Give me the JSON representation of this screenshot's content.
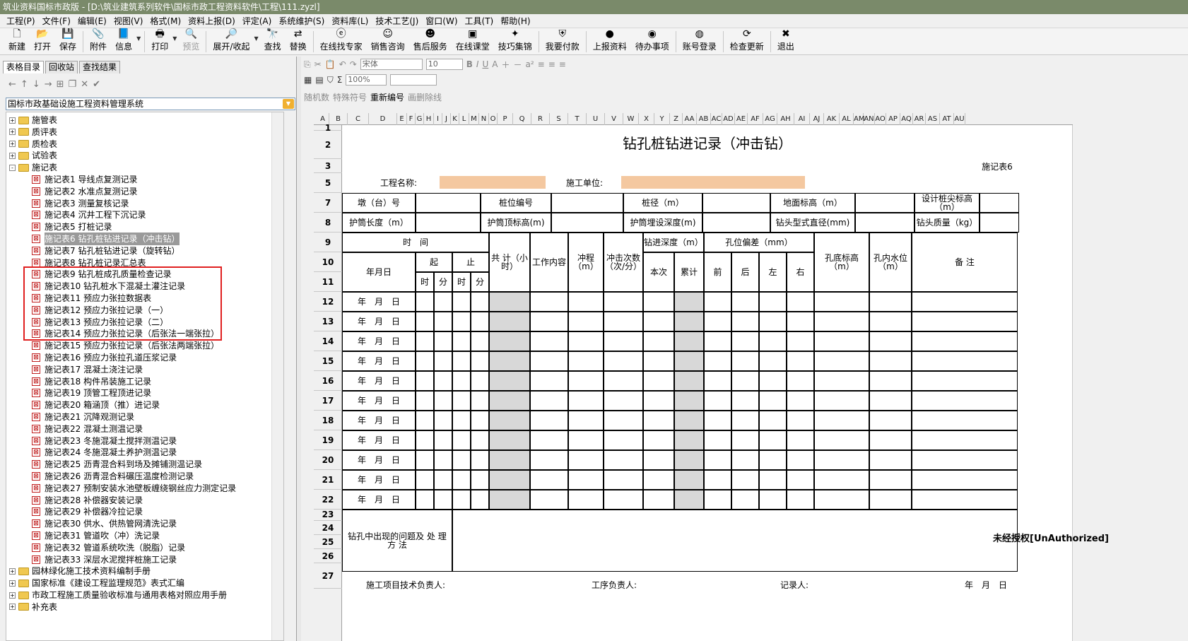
{
  "window": {
    "title": "筑业资料国标市政版 - [D:\\筑业建筑系列软件\\国标市政工程资料软件\\工程\\111.zyzl]"
  },
  "menu": [
    {
      "id": "project",
      "label": "工程(P)"
    },
    {
      "id": "file",
      "label": "文件(F)"
    },
    {
      "id": "edit",
      "label": "编辑(E)"
    },
    {
      "id": "view",
      "label": "视图(V)"
    },
    {
      "id": "format",
      "label": "格式(M)"
    },
    {
      "id": "upload",
      "label": "资料上报(D)"
    },
    {
      "id": "evaluate",
      "label": "评定(A)"
    },
    {
      "id": "maintain",
      "label": "系统维护(S)"
    },
    {
      "id": "library",
      "label": "资料库(L)"
    },
    {
      "id": "tech",
      "label": "技术工艺(J)"
    },
    {
      "id": "window",
      "label": "窗口(W)"
    },
    {
      "id": "tools",
      "label": "工具(T)"
    },
    {
      "id": "help",
      "label": "帮助(H)"
    }
  ],
  "toolbar": [
    {
      "id": "new",
      "label": "新建",
      "icon": "new-doc-icon",
      "glyph": "🗋"
    },
    {
      "id": "open",
      "label": "打开",
      "icon": "open-folder-icon",
      "glyph": "📂"
    },
    {
      "id": "save",
      "label": "保存",
      "icon": "save-icon",
      "glyph": "💾"
    },
    {
      "id": "attach",
      "label": "附件",
      "icon": "attachment-icon",
      "glyph": "📎",
      "sep": true
    },
    {
      "id": "info",
      "label": "信息",
      "icon": "info-icon",
      "glyph": "📘",
      "arrow": true
    },
    {
      "id": "print",
      "label": "打印",
      "icon": "printer-icon",
      "glyph": "🖶",
      "arrow": true,
      "sep": true
    },
    {
      "id": "preview",
      "label": "预览",
      "icon": "preview-icon",
      "glyph": "🔍",
      "disabled": true
    },
    {
      "id": "expand",
      "label": "展开/收起",
      "icon": "expand-icon",
      "glyph": "🔎",
      "arrow": true,
      "sep": true
    },
    {
      "id": "find",
      "label": "查找",
      "icon": "binoculars-icon",
      "glyph": "🔭"
    },
    {
      "id": "replace",
      "label": "替换",
      "icon": "replace-icon",
      "glyph": "⇄"
    },
    {
      "id": "expert",
      "label": "在线找专家",
      "icon": "expert-icon",
      "glyph": "ⓔ",
      "sep": true
    },
    {
      "id": "sales",
      "label": "销售咨询",
      "icon": "sales-icon",
      "glyph": "☺"
    },
    {
      "id": "service",
      "label": "售后服务",
      "icon": "service-icon",
      "glyph": "☻"
    },
    {
      "id": "classroom",
      "label": "在线课堂",
      "icon": "classroom-icon",
      "glyph": "▣"
    },
    {
      "id": "tips",
      "label": "技巧集锦",
      "icon": "tips-icon",
      "glyph": "✦"
    },
    {
      "id": "pay",
      "label": "我要付款",
      "icon": "pay-icon",
      "glyph": "⛨",
      "sep": true
    },
    {
      "id": "report",
      "label": "上报资料",
      "icon": "report-icon",
      "glyph": "●",
      "sep": true
    },
    {
      "id": "todo",
      "label": "待办事项",
      "icon": "todo-icon",
      "glyph": "◉"
    },
    {
      "id": "login",
      "label": "账号登录",
      "icon": "login-icon",
      "glyph": "◍",
      "sep": true
    },
    {
      "id": "update",
      "label": "检查更新",
      "icon": "update-icon",
      "glyph": "⟳",
      "sep": true
    },
    {
      "id": "exit",
      "label": "退出",
      "icon": "exit-icon",
      "glyph": "✖",
      "sep": true
    }
  ],
  "left": {
    "tabs": [
      "表格目录",
      "回收站",
      "查找结果"
    ],
    "system": "国标市政基础设施工程资料管理系统",
    "tree": [
      {
        "label": "施管表",
        "type": "folder",
        "exp": "+"
      },
      {
        "label": "质评表",
        "type": "folder",
        "exp": "+"
      },
      {
        "label": "质检表",
        "type": "folder",
        "exp": "+"
      },
      {
        "label": "试验表",
        "type": "folder",
        "exp": "+"
      },
      {
        "label": "施记表",
        "type": "folder",
        "exp": "-",
        "open": true
      },
      {
        "label": "施记表1  导线点复测记录",
        "type": "doc"
      },
      {
        "label": "施记表2  水准点复测记录",
        "type": "doc"
      },
      {
        "label": "施记表3  测量复核记录",
        "type": "doc"
      },
      {
        "label": "施记表4  沉井工程下沉记录",
        "type": "doc"
      },
      {
        "label": "施记表5  打桩记录",
        "type": "doc"
      },
      {
        "label": "施记表6  钻孔桩钻进记录（冲击钻）",
        "type": "doc",
        "selected": true
      },
      {
        "label": "施记表7  钻孔桩钻进记录（旋转钻）",
        "type": "doc"
      },
      {
        "label": "施记表8  钻孔桩记录汇总表",
        "type": "doc"
      },
      {
        "label": "施记表9  钻孔桩成孔质量检查记录",
        "type": "doc"
      },
      {
        "label": "施记表10  钻孔桩水下混凝土灌注记录",
        "type": "doc"
      },
      {
        "label": "施记表11  预应力张拉数据表",
        "type": "doc"
      },
      {
        "label": "施记表12  预应力张拉记录（一）",
        "type": "doc"
      },
      {
        "label": "施记表13  预应力张拉记录（二）",
        "type": "doc"
      },
      {
        "label": "施记表14  预应力张拉记录（后张法一端张拉）",
        "type": "doc"
      },
      {
        "label": "施记表15  预应力张拉记录（后张法两端张拉）",
        "type": "doc"
      },
      {
        "label": "施记表16  预应力张拉孔道压浆记录",
        "type": "doc"
      },
      {
        "label": "施记表17  混凝土浇注记录",
        "type": "doc"
      },
      {
        "label": "施记表18  构件吊装施工记录",
        "type": "doc"
      },
      {
        "label": "施记表19  顶管工程顶进记录",
        "type": "doc"
      },
      {
        "label": "施记表20  箱涵顶（推）进记录",
        "type": "doc"
      },
      {
        "label": "施记表21  沉降观测记录",
        "type": "doc"
      },
      {
        "label": "施记表22  混凝土测温记录",
        "type": "doc"
      },
      {
        "label": "施记表23  冬施混凝土搅拌测温记录",
        "type": "doc"
      },
      {
        "label": "施记表24  冬施混凝土养护测温记录",
        "type": "doc"
      },
      {
        "label": "施记表25  沥青混合料到场及摊铺测温记录",
        "type": "doc"
      },
      {
        "label": "施记表26  沥青混合料碾压温度检测记录",
        "type": "doc"
      },
      {
        "label": "施记表27  预制安装水池壁板缠绕钢丝应力测定记录",
        "type": "doc"
      },
      {
        "label": "施记表28  补偿器安装记录",
        "type": "doc"
      },
      {
        "label": "施记表29  补偿器冷拉记录",
        "type": "doc"
      },
      {
        "label": "施记表30  供水、供热管网清洗记录",
        "type": "doc"
      },
      {
        "label": "施记表31  管道吹（冲）洗记录",
        "type": "doc"
      },
      {
        "label": "施记表32  管道系统吹洗（脱脂）记录",
        "type": "doc"
      },
      {
        "label": "施记表33  深层水泥搅拌桩施工记录",
        "type": "doc"
      },
      {
        "label": "园林绿化施工技术资料编制手册",
        "type": "folder",
        "exp": "+",
        "root": true
      },
      {
        "label": "国家标准《建设工程监理规范》表式汇编",
        "type": "folder",
        "exp": "+",
        "root": true
      },
      {
        "label": "市政工程施工质量验收标准与通用表格对照应用手册",
        "type": "folder",
        "exp": "+",
        "root": true
      },
      {
        "label": "补充表",
        "type": "folder",
        "exp": "+",
        "root": true
      }
    ]
  },
  "format": {
    "font": "宋体",
    "size": "10",
    "zoom": "100%",
    "random": "随机数",
    "special": "特殊符号",
    "renumber": "重新编号",
    "diag": "画删除线"
  },
  "columns": [
    "A",
    "B",
    "C",
    "D",
    "E",
    "F",
    "G",
    "H",
    "I",
    "J",
    "K",
    "L",
    "M",
    "N",
    "O",
    "P",
    "Q",
    "R",
    "S",
    "T",
    "U",
    "V",
    "W",
    "X",
    "Y",
    "Z",
    "AA",
    "AB",
    "AC",
    "AD",
    "AE",
    "AF",
    "AG",
    "AH",
    "AI",
    "AJ",
    "AK",
    "AL",
    "AM",
    "AN",
    "AO",
    "AP",
    "AQ",
    "AR",
    "AS",
    "AT",
    "AU"
  ],
  "rows": [
    "1",
    "2",
    "3",
    "5",
    "7",
    "8",
    "9",
    "10",
    "11",
    "12",
    "13",
    "14",
    "15",
    "16",
    "17",
    "18",
    "19",
    "20",
    "21",
    "22",
    "23",
    "24",
    "25",
    "26",
    "27"
  ],
  "form": {
    "title": "钻孔桩钻进记录（冲击钻）",
    "code": "施记表6",
    "project_name": "工程名称:",
    "construction_unit": "施工单位:",
    "r7": [
      "墩（台）号",
      "桩位编号",
      "桩径（m）",
      "地面标高（m）",
      "设计桩尖标高（m）"
    ],
    "r8": [
      "护筒长度（m）",
      "护筒顶标高(m)",
      "护筒埋设深度(m)",
      "钻头型式直径(mm)",
      "钻头质量（kg）"
    ],
    "time": "时　间",
    "date": "年月日",
    "start": "起",
    "end": "止",
    "hour": "时",
    "minute": "分",
    "total": "共 计（小时）",
    "work": "工作内容",
    "stroke": "冲程（m）",
    "count": "冲击次数（次/分）",
    "depth": "钻进深度（m）",
    "this_time": "本次",
    "cumulative": "累计",
    "deviation": "孔位偏差（mm）",
    "front": "前",
    "back": "后",
    "left": "左",
    "right": "右",
    "bottom": "孔底标高（m）",
    "water": "孔内水位（m）",
    "remark": "备 注",
    "ymd": "年　月　日",
    "problem": "钻孔中出现的问题及 处 理 方 法",
    "tech_lead": "施工项目技术负责人:",
    "process_lead": "工序负责人:",
    "recorder": "记录人:"
  },
  "watermark": "未经授权[UnAuthorized]"
}
